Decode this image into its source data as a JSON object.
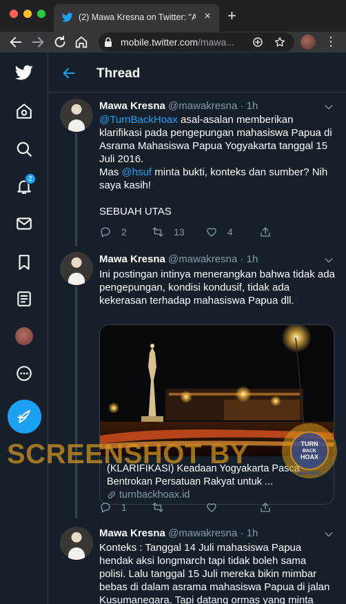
{
  "browser": {
    "tab_title": "(2) Mawa Kresna on Twitter: \"A",
    "tab_close": "×",
    "new_tab": "+",
    "url_host": "mobile.twitter.com",
    "url_path": "/mawa...",
    "menu": "⋮"
  },
  "nav": {
    "notifications_badge": "2",
    "items": [
      "home-icon",
      "search-icon",
      "bell-icon",
      "mail-icon",
      "bookmark-icon",
      "list-icon",
      "avatar",
      "more-icon",
      "compose-icon"
    ]
  },
  "header": {
    "title": "Thread"
  },
  "tweets": [
    {
      "name": "Mawa Kresna",
      "handle": "@mawakresna · 1h",
      "mention1": "@TurnBackHoax",
      "text1": " asal-asalan memberikan klarifikasi pada pengepungan mahasiswa Papua di Asrama Mahasiswa Papua Yogyakarta tanggal 15 Juli 2016.",
      "text2": "Mas ",
      "mention2": "@hsuf",
      "text3": " minta bukti, konteks dan sumber? Nih saya kasih!",
      "text4": "SEBUAH UTAS",
      "replies": "2",
      "retweets": "13",
      "likes": "4"
    },
    {
      "name": "Mawa Kresna",
      "handle": "@mawakresna · 1h",
      "text": "Ini postingan intinya menerangkan bahwa tidak ada pengepungan, kondisi kondusif, tidak ada kekerasan terhadap mahasiswa Papua dll.",
      "card_title": "(KLARIFIKASI) Keadaan Yogyakarta Pasca Bentrokan Persatuan Rakyat untuk ...",
      "card_domain": "turnbackhoax.id",
      "replies": "1"
    },
    {
      "name": "Mawa Kresna",
      "handle": "@mawakresna · 1h",
      "text": "Konteks : Tanggal 14 Juli mahasiswa Papua hendak aksi longmarch tapi tidak boleh sama polisi. Lalu tanggal 15 Juli mereka bikin mimbar bebas di dalam asrama mahasiswa Papua di jalan Kusumanegara. Tapi datang ormas yang minta"
    }
  ],
  "watermark": {
    "text": "SCREENSHOT BY",
    "logo_top": "MASYARAKAT ANTI FITNAH INDONESIA",
    "logo_mid1": "TURN",
    "logo_mid2": "BACK",
    "logo_mid3": "HOAX",
    "logo_bottom": "MAFINDO"
  },
  "colors": {
    "background": "#15202b",
    "accent": "#1da1f2",
    "border": "#38444d",
    "secondary_text": "#8899a6"
  }
}
